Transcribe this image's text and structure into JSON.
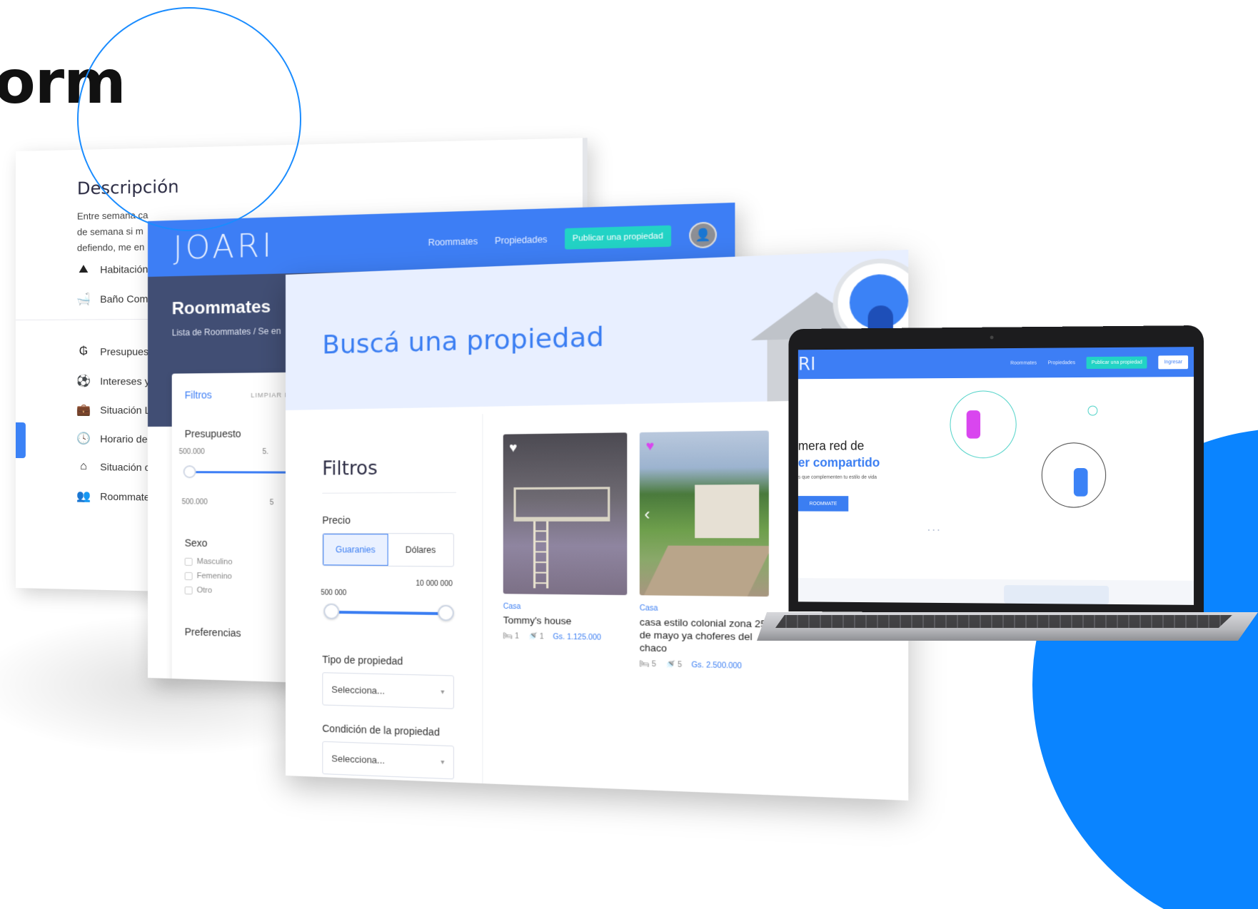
{
  "hero": {
    "heading": "orm"
  },
  "description_screen": {
    "title": "Descripción",
    "text_lines": [
      "Entre semana ca",
      "de semana si m",
      "defiendo, me en"
    ],
    "features": [
      {
        "icon": "mountain-icon",
        "label": "Habitación"
      },
      {
        "icon": "bathtub-icon",
        "label": "Baño Com"
      }
    ],
    "details": [
      {
        "icon": "guarani-icon",
        "label": "Presupuest"
      },
      {
        "icon": "soccer-ball-icon",
        "label": "Intereses y"
      },
      {
        "icon": "briefcase-icon",
        "label": "Situación L"
      },
      {
        "icon": "clock-icon",
        "label": "Horario de"
      },
      {
        "icon": "house-icon",
        "label": "Situación c"
      },
      {
        "icon": "users-icon",
        "label": "Roommate"
      }
    ]
  },
  "roommates_screen": {
    "logo": "JOARI",
    "nav": {
      "roommates": "Roommates",
      "propiedades": "Propiedades",
      "publish": "Publicar una propiedad"
    },
    "title": "Roommates",
    "breadcrumb": "Lista de Roommates  /  Se en",
    "filters": {
      "title": "Filtros",
      "clear": "LIMPIAR FI",
      "budget_label": "Presupuesto",
      "budget_min": "500.000",
      "budget_max_partial": "5.",
      "budget_min_bottom": "500.000",
      "budget_max_bottom_partial": "5",
      "sex_label": "Sexo",
      "sex_options": [
        "Masculino",
        "Femenino",
        "Otro"
      ],
      "preferences_partial": "Preferencias"
    }
  },
  "search_screen": {
    "title": "Buscá una propiedad",
    "filters_title": "Filtros",
    "price_label": "Precio",
    "currency_options": [
      "Guaranies",
      "Dólares"
    ],
    "currency_selected": "Guaranies",
    "range_min": "500 000",
    "range_max": "10 000 000",
    "property_type_label": "Tipo de propiedad",
    "property_type_value": "Selecciona...",
    "condition_label": "Condición de la propiedad",
    "condition_value": "Selecciona...",
    "listings": [
      {
        "type": "Casa",
        "name": "Tommy's house",
        "rooms": "1",
        "baths": "1",
        "price": "Gs. 1.125.000",
        "favorite": "white"
      },
      {
        "type": "Casa",
        "name": "casa estilo colonial zona 25 de mayo ya choferes del chaco",
        "rooms": "5",
        "baths": "5",
        "price": "Gs. 2.500.000",
        "favorite": "pink"
      }
    ]
  },
  "laptop_screen": {
    "logo_partial": "RI",
    "nav": {
      "roommates": "Roommates",
      "propiedades": "Propiedades",
      "publish": "Publicar una propiedad",
      "login": "Ingresar"
    },
    "headline_1": "mera red de",
    "headline_2": "er compartido",
    "subtitle": "s que complementen tu estilo de vida",
    "cta": "ROOMMATE",
    "carousel_dots": "• • •"
  },
  "colors": {
    "primary": "#3d7ef5",
    "accent_teal": "#22d3c5",
    "hero_dark": "#414e74",
    "decor_blue": "#0a84ff"
  }
}
